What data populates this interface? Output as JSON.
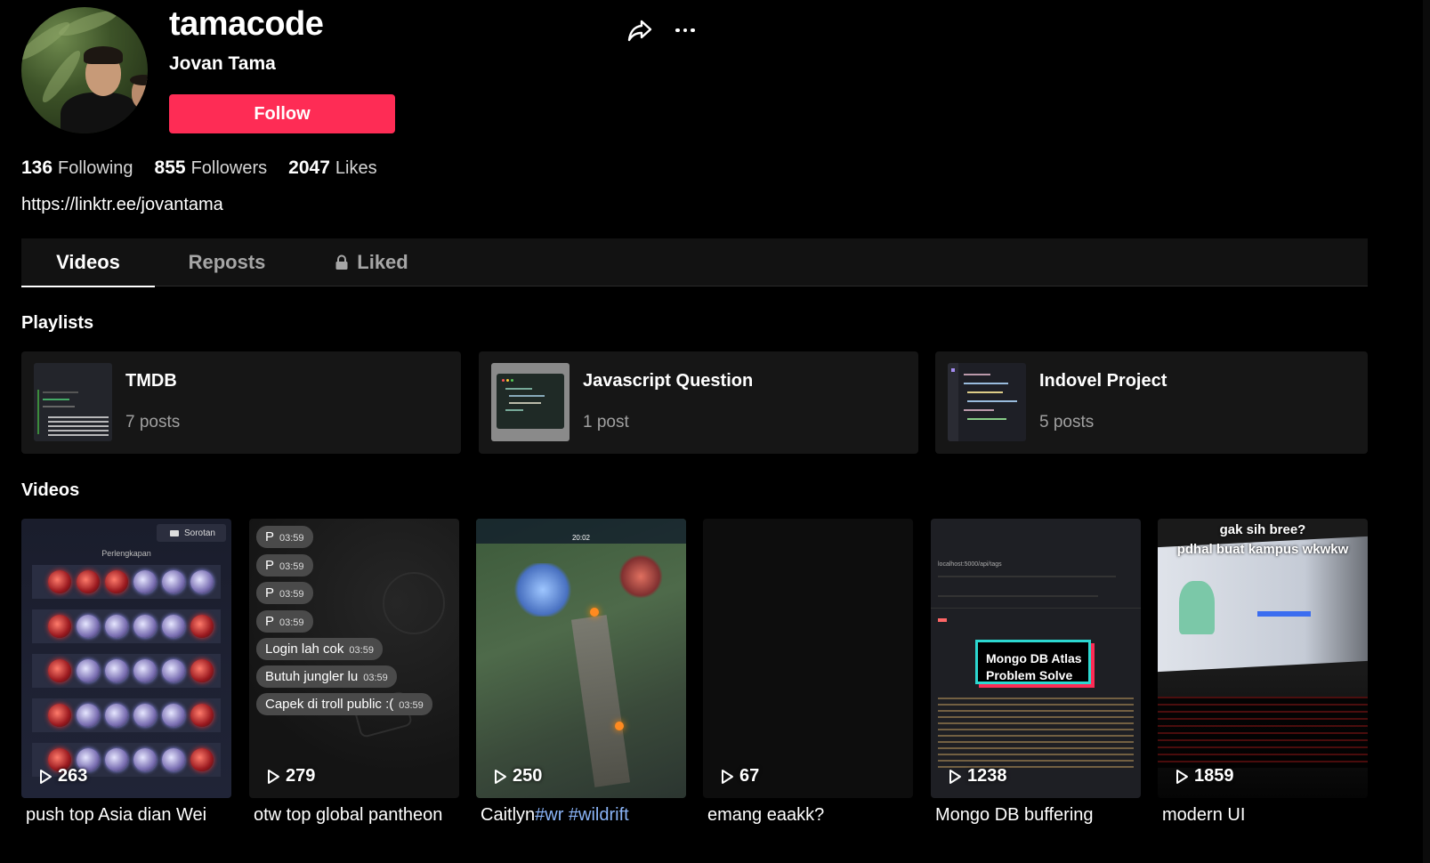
{
  "profile": {
    "username": "tamacode",
    "display_name": "Jovan Tama",
    "follow_label": "Follow",
    "bio_link": "https://linktr.ee/jovantama",
    "accent_color": "#fe2c55"
  },
  "stats": {
    "following": {
      "value": "136",
      "label": "Following"
    },
    "followers": {
      "value": "855",
      "label": "Followers"
    },
    "likes": {
      "value": "2047",
      "label": "Likes"
    }
  },
  "tabs": [
    {
      "label": "Videos",
      "active": true
    },
    {
      "label": "Reposts",
      "active": false
    },
    {
      "label": "Liked",
      "active": false,
      "icon": "lock-icon"
    }
  ],
  "playlists_title": "Playlists",
  "playlists": [
    {
      "name": "TMDB",
      "count": "7 posts"
    },
    {
      "name": "Javascript Question",
      "count": "1 post"
    },
    {
      "name": "Indovel Project",
      "count": "5 posts"
    }
  ],
  "videos_title": "Videos",
  "videos": [
    {
      "views": "263",
      "caption": "push top Asia dian Wei",
      "thumb": {
        "badge": "Sorotan",
        "heading": "Perlengkapan"
      }
    },
    {
      "views": "279",
      "caption": "otw top global pantheon",
      "thumb": {
        "messages": [
          {
            "text": "P",
            "time": "03:59"
          },
          {
            "text": "P",
            "time": "03:59"
          },
          {
            "text": "P",
            "time": "03:59"
          },
          {
            "text": "P",
            "time": "03:59"
          },
          {
            "text": "Login lah cok",
            "time": "03:59"
          },
          {
            "text": "Butuh jungler lu",
            "time": "03:59"
          },
          {
            "text": "Capek di troll public :(",
            "time": "03:59"
          }
        ]
      }
    },
    {
      "views": "250",
      "caption_prefix": "Caitlyn",
      "caption_tags": "#wr #wildrift",
      "thumb": {
        "timer": "20:02"
      }
    },
    {
      "views": "67",
      "caption": "emang eaakk?"
    },
    {
      "views": "1238",
      "caption": "Mongo DB buffering",
      "thumb": {
        "overlay": [
          "Mongo DB Atlas",
          "Problem Solve"
        ],
        "url": "localhost:5000/api/tags"
      }
    },
    {
      "views": "1859",
      "caption": "modern UI",
      "thumb": {
        "overlay": [
          "gak sih bree?",
          "pdhal buat kampus wkwkw"
        ]
      }
    }
  ]
}
